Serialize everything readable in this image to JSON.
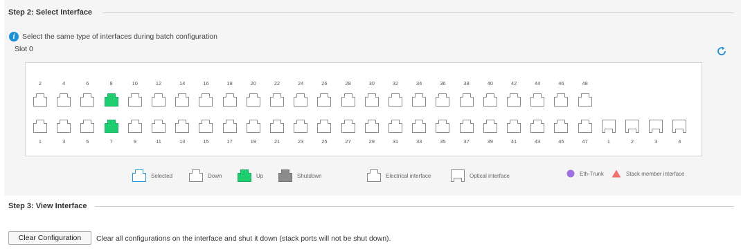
{
  "step2": {
    "title": "Step 2: Select Interface"
  },
  "info": {
    "text": "Select the same type of interfaces during batch configuration"
  },
  "slot": {
    "label": "Slot 0"
  },
  "board": {
    "top_numbers": [
      "2",
      "4",
      "6",
      "8",
      "10",
      "12",
      "14",
      "16",
      "18",
      "20",
      "22",
      "24",
      "26",
      "28",
      "30",
      "32",
      "34",
      "36",
      "38",
      "40",
      "42",
      "44",
      "46",
      "48"
    ],
    "bottom_numbers": [
      "1",
      "3",
      "5",
      "7",
      "9",
      "11",
      "13",
      "15",
      "17",
      "19",
      "21",
      "23",
      "25",
      "27",
      "29",
      "31",
      "33",
      "35",
      "37",
      "39",
      "41",
      "43",
      "45",
      "47"
    ],
    "optical_numbers": [
      "1",
      "2",
      "3",
      "4"
    ],
    "up_ports": [
      "7",
      "8"
    ]
  },
  "legend": {
    "selected": "Selected",
    "down": "Down",
    "up": "Up",
    "shutdown": "Shutdown",
    "electrical": "Electrical interface",
    "optical": "Optical interface",
    "eth_trunk": "Eth-Trunk",
    "stack_member": "Stack member interface"
  },
  "colors": {
    "selected": "#1e9bd7",
    "up": "#1fcc70",
    "shutdown": "#8c8c8c",
    "eth_trunk": "#a070e0",
    "stack_member": "#f07070",
    "accent": "#1e90d6"
  },
  "step3": {
    "title": "Step 3: View Interface"
  },
  "actions": {
    "clear_button": "Clear Configuration",
    "clear_description": "Clear all configurations on the interface and shut it down (stack ports will not be shut down)."
  }
}
